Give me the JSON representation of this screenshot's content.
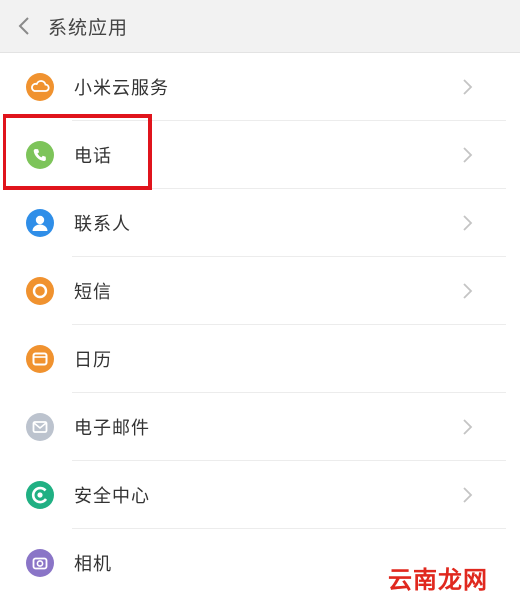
{
  "header": {
    "title": "系统应用"
  },
  "items": [
    {
      "label": "小米云服务",
      "icon": "cloud-icon",
      "color": "#f0922f"
    },
    {
      "label": "电话",
      "icon": "phone-icon",
      "color": "#7dc45a"
    },
    {
      "label": "联系人",
      "icon": "contact-icon",
      "color": "#2f8ee8"
    },
    {
      "label": "短信",
      "icon": "message-icon",
      "color": "#f0922f"
    },
    {
      "label": "日历",
      "icon": "calendar-icon",
      "color": "#f0922f"
    },
    {
      "label": "电子邮件",
      "icon": "mail-icon",
      "color": "#bcc3ce"
    },
    {
      "label": "安全中心",
      "icon": "security-icon",
      "color": "#20b083"
    },
    {
      "label": "相机",
      "icon": "camera-icon",
      "color": "#8a75c7"
    }
  ],
  "highlight_color": "#e0141c",
  "watermark": "云南龙网"
}
